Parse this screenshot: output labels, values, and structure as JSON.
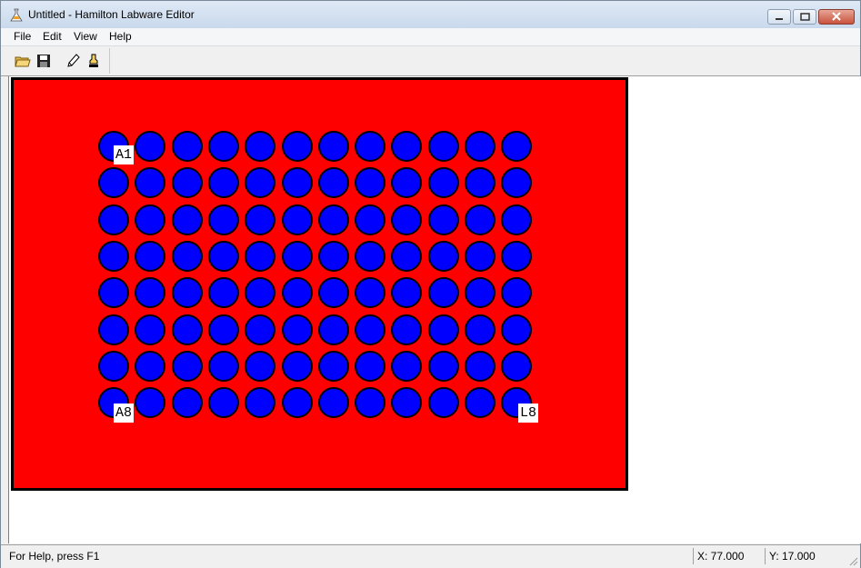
{
  "window": {
    "title": "Untitled - Hamilton Labware Editor"
  },
  "menu": [
    "File",
    "Edit",
    "View",
    "Help"
  ],
  "toolbar": {
    "buttons": [
      "open-folder-icon",
      "save-disk-icon",
      "pencil-icon",
      "stamp-icon"
    ]
  },
  "plate": {
    "rows": 8,
    "columns": 12,
    "labels": {
      "first": "A1",
      "last_row_first": "A8",
      "last": "L8"
    },
    "colors": {
      "plate": "#ff0000",
      "well": "#0000ff",
      "border": "#000000"
    }
  },
  "status": {
    "help": "For Help, press F1",
    "x": "X: 77.000",
    "y": "Y: 17.000"
  }
}
